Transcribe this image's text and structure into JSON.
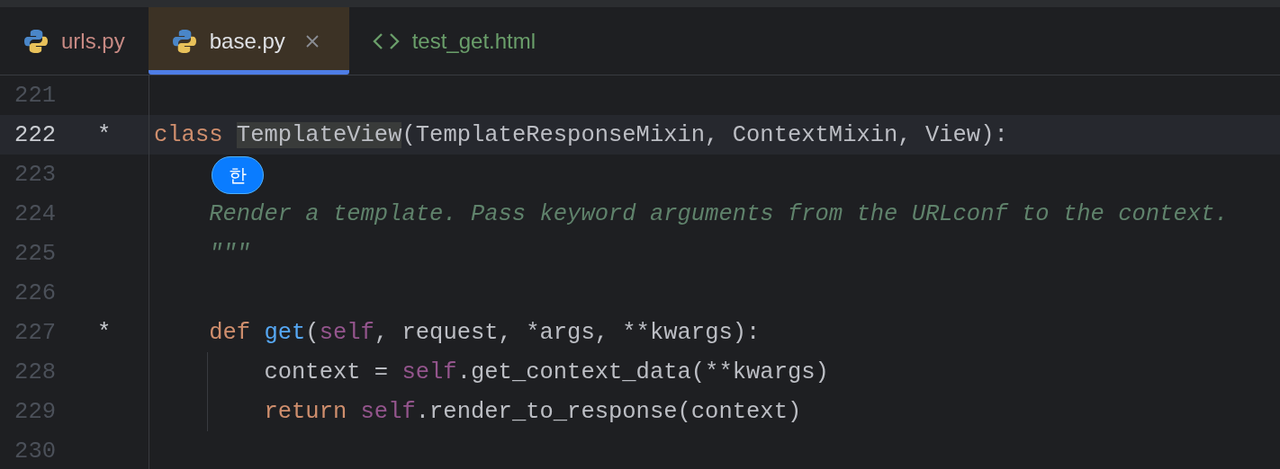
{
  "tabs": [
    {
      "label": "urls.py",
      "kind": "python",
      "selected": false,
      "closable": false
    },
    {
      "label": "base.py",
      "kind": "python",
      "selected": true,
      "closable": true
    },
    {
      "label": "test_get.html",
      "kind": "html",
      "selected": false,
      "closable": false
    }
  ],
  "editor": {
    "lines": [
      {
        "number": "221",
        "current": false
      },
      {
        "number": "222",
        "current": true,
        "marker": "*",
        "tokens": [
          {
            "kind": "keyword",
            "text": "class "
          },
          {
            "kind": "highlight",
            "text": "TemplateView"
          },
          {
            "kind": "plain",
            "text": "(TemplateResponseMixin, ContextMixin, View):"
          }
        ]
      },
      {
        "number": "223",
        "current": false,
        "ime_badge": "한"
      },
      {
        "number": "224",
        "current": false,
        "tokens": [
          {
            "kind": "doc",
            "text": "    Render a template. Pass keyword arguments from the URLconf to the context."
          }
        ]
      },
      {
        "number": "225",
        "current": false,
        "tokens": [
          {
            "kind": "doc",
            "text": "    \"\"\""
          }
        ]
      },
      {
        "number": "226",
        "current": false
      },
      {
        "number": "227",
        "current": false,
        "marker": "*",
        "tokens": [
          {
            "kind": "keyword",
            "text": "    def "
          },
          {
            "kind": "func",
            "text": "get"
          },
          {
            "kind": "plain",
            "text": "("
          },
          {
            "kind": "self",
            "text": "self"
          },
          {
            "kind": "plain",
            "text": ", request, *args, **kwargs):"
          }
        ]
      },
      {
        "number": "228",
        "current": false,
        "guide": true,
        "tokens": [
          {
            "kind": "plain",
            "text": "        context = "
          },
          {
            "kind": "self",
            "text": "self"
          },
          {
            "kind": "plain",
            "text": ".get_context_data(**kwargs)"
          }
        ]
      },
      {
        "number": "229",
        "current": false,
        "guide": true,
        "tokens": [
          {
            "kind": "keyword",
            "text": "        return "
          },
          {
            "kind": "self",
            "text": "self"
          },
          {
            "kind": "plain",
            "text": ".render_to_response(context)"
          }
        ]
      },
      {
        "number": "230",
        "current": false
      }
    ]
  }
}
